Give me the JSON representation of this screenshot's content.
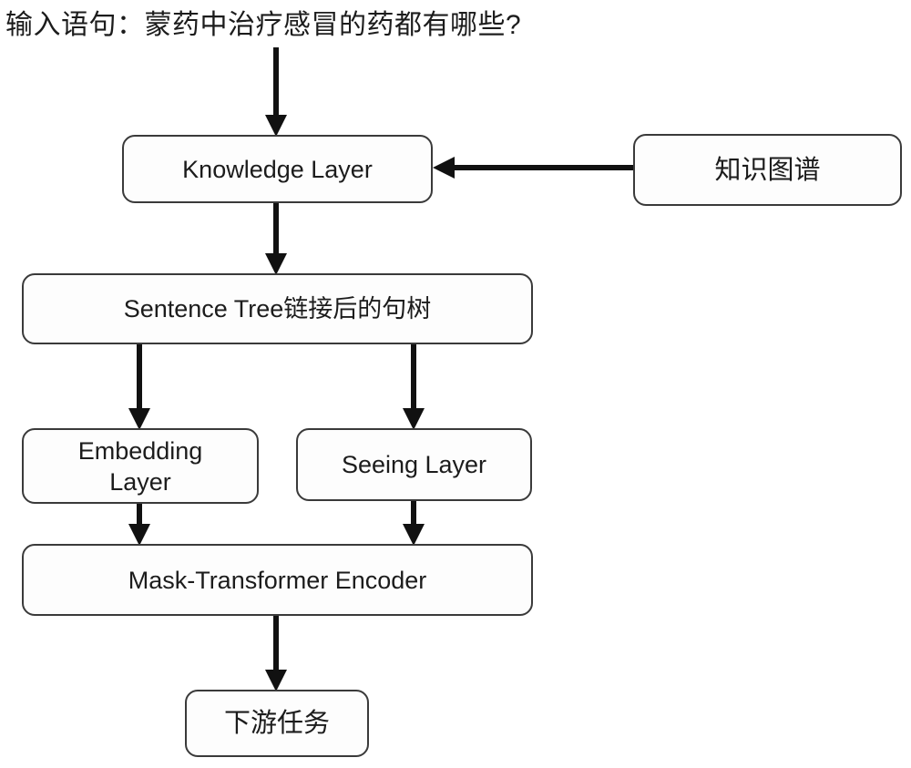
{
  "diagram": {
    "caption": "输入语句：蒙药中治疗感冒的药都有哪些?",
    "nodes": {
      "knowledge_layer": "Knowledge Layer",
      "knowledge_graph": "知识图谱",
      "sentence_tree": "Sentence Tree链接后的句树",
      "embedding_layer_line1": "Embedding",
      "embedding_layer_line2": "Layer",
      "seeing_layer": "Seeing Layer",
      "mask_transformer_encoder": "Mask-Transformer Encoder",
      "downstream_task": "下游任务"
    },
    "edges": [
      {
        "name": "caption-to-knowledge-layer",
        "from": "caption",
        "to": "knowledge_layer",
        "direction": "down"
      },
      {
        "name": "knowledge-graph-to-knowledge-layer",
        "from": "knowledge_graph",
        "to": "knowledge_layer",
        "direction": "left"
      },
      {
        "name": "knowledge-layer-to-sentence-tree",
        "from": "knowledge_layer",
        "to": "sentence_tree",
        "direction": "down"
      },
      {
        "name": "sentence-tree-to-embedding-layer",
        "from": "sentence_tree",
        "to": "embedding_layer",
        "direction": "down"
      },
      {
        "name": "sentence-tree-to-seeing-layer",
        "from": "sentence_tree",
        "to": "seeing_layer",
        "direction": "down"
      },
      {
        "name": "embedding-layer-to-mask-transformer",
        "from": "embedding_layer",
        "to": "mask_transformer_encoder",
        "direction": "down"
      },
      {
        "name": "seeing-layer-to-mask-transformer",
        "from": "seeing_layer",
        "to": "mask_transformer_encoder",
        "direction": "down"
      },
      {
        "name": "mask-transformer-to-downstream-task",
        "from": "mask_transformer_encoder",
        "to": "downstream_task",
        "direction": "down"
      }
    ],
    "colors": {
      "background": "#ffffff",
      "node_border": "#3a3a3a",
      "node_fill": "#fdfdfd",
      "edge": "#111111",
      "text": "#1c1c1c"
    }
  }
}
